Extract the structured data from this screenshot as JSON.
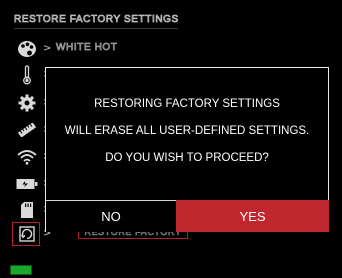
{
  "menu": {
    "title": "RESTORE FACTORY SETTINGS",
    "submenu_value": "WHITE HOT",
    "restore_label": "RESTORE FACTORY",
    "chevron": ">"
  },
  "icons": [
    "palette-icon",
    "thermometer-icon",
    "gear-icon",
    "ruler-icon",
    "wifi-icon",
    "battery-charge-icon",
    "sd-card-icon",
    "restore-icon"
  ],
  "dialog": {
    "line1": "RESTORING FACTORY SETTINGS",
    "line2": "WILL ERASE ALL USER-DEFINED SETTINGS.",
    "line3": "DO YOU WISH TO PROCEED?",
    "no_label": "NO",
    "yes_label": "YES"
  },
  "colors": {
    "accent": "#c0262e",
    "battery": "#1aa82b"
  }
}
